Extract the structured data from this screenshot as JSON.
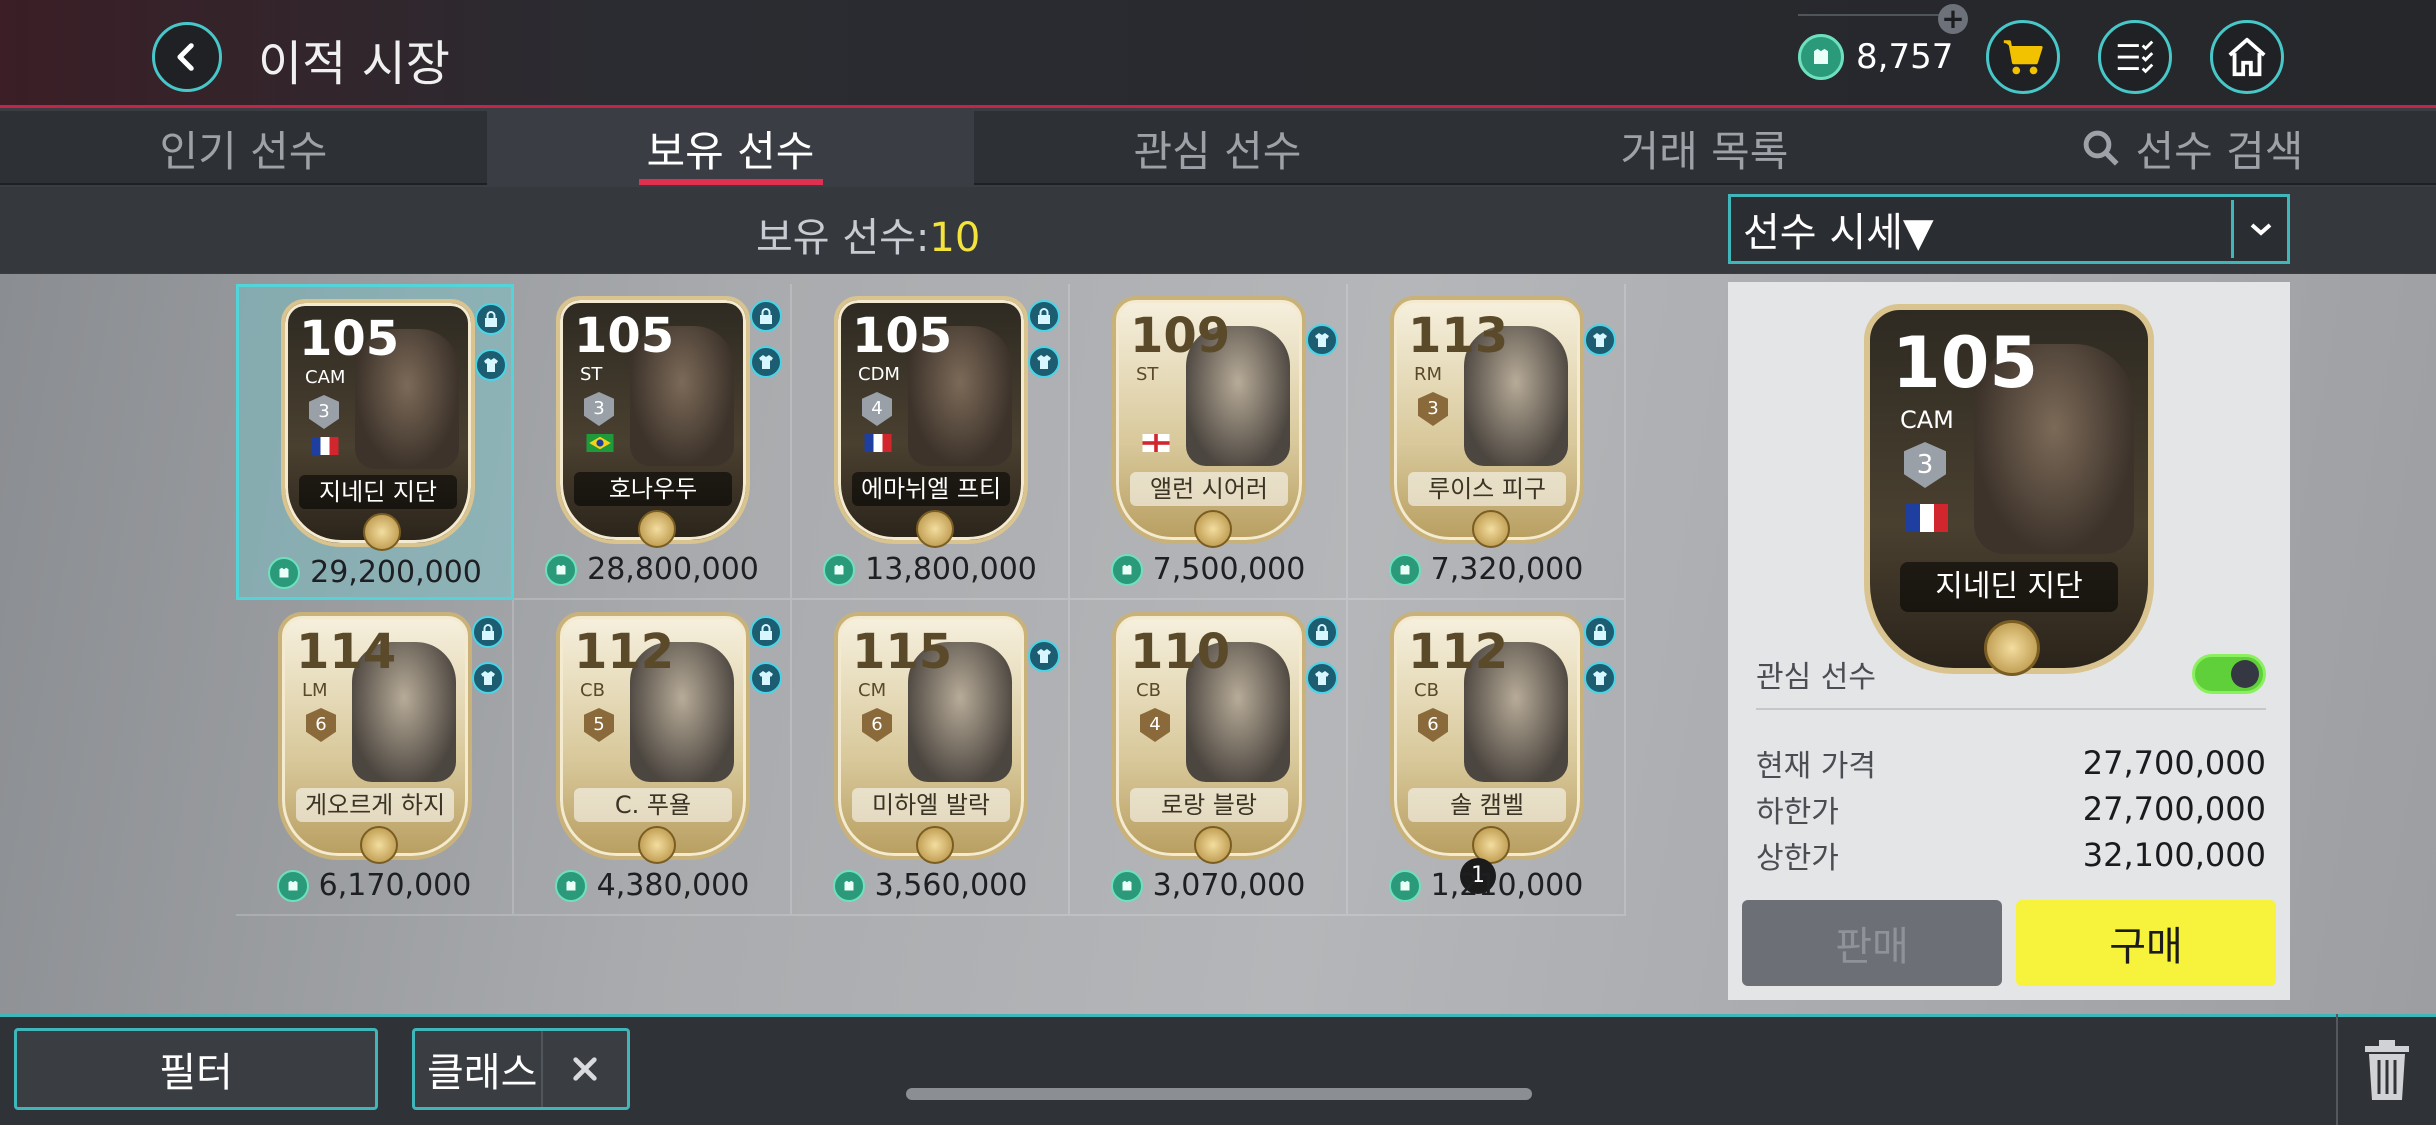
{
  "header": {
    "title": "이적 시장",
    "currency": "8,757",
    "icons": [
      "back-icon",
      "coin-icon",
      "plus-icon",
      "cart-icon",
      "list-check-icon",
      "home-icon"
    ]
  },
  "tabs": [
    {
      "label": "인기 선수",
      "active": false
    },
    {
      "label": "보유 선수",
      "active": true
    },
    {
      "label": "관심 선수",
      "active": false
    },
    {
      "label": "거래 목록",
      "active": false
    },
    {
      "label": "선수 검색",
      "active": false,
      "icon": "search-icon"
    }
  ],
  "owned": {
    "label": "보유 선수:",
    "count": "10"
  },
  "sort": {
    "selected": "선수 시세▼"
  },
  "players": [
    {
      "ovr": "105",
      "pos": "CAM",
      "lvl": "3",
      "name": "지네딘 지단",
      "price": "29,200,000",
      "dark": true,
      "locked": true,
      "selected": true,
      "flag": "fr"
    },
    {
      "ovr": "105",
      "pos": "ST",
      "lvl": "3",
      "name": "호나우두",
      "price": "28,800,000",
      "dark": true,
      "locked": true,
      "flag": "br"
    },
    {
      "ovr": "105",
      "pos": "CDM",
      "lvl": "4",
      "name": "에마뉘엘 프티",
      "price": "13,800,000",
      "dark": true,
      "locked": true,
      "flag": "fr"
    },
    {
      "ovr": "109",
      "pos": "ST",
      "lvl": "",
      "name": "앨런 시어러",
      "price": "7,500,000",
      "dark": false,
      "locked": false,
      "flag": "en"
    },
    {
      "ovr": "113",
      "pos": "RM",
      "lvl": "3",
      "name": "루이스 피구",
      "price": "7,320,000",
      "dark": false,
      "locked": false,
      "flag": ""
    },
    {
      "ovr": "114",
      "pos": "LM",
      "lvl": "6",
      "name": "게오르게 하지",
      "price": "6,170,000",
      "dark": false,
      "locked": true,
      "flag": ""
    },
    {
      "ovr": "112",
      "pos": "CB",
      "lvl": "5",
      "name": "C. 푸욜",
      "price": "4,380,000",
      "dark": false,
      "locked": true,
      "flag": ""
    },
    {
      "ovr": "115",
      "pos": "CM",
      "lvl": "6",
      "name": "미하엘 발락",
      "price": "3,560,000",
      "dark": false,
      "locked": false,
      "flag": ""
    },
    {
      "ovr": "110",
      "pos": "CB",
      "lvl": "4",
      "name": "로랑 블랑",
      "price": "3,070,000",
      "dark": false,
      "locked": true,
      "flag": ""
    },
    {
      "ovr": "112",
      "pos": "CB",
      "lvl": "6",
      "name": "솔 캠벨",
      "price": "1,210,000",
      "dark": false,
      "locked": true,
      "flag": "",
      "rank": "1"
    }
  ],
  "detail": {
    "ovr": "105",
    "pos": "CAM",
    "lvl": "3",
    "name": "지네딘 지단",
    "watch_label": "관심 선수",
    "watch_on": true,
    "rows": [
      {
        "label": "현재 가격",
        "value": "27,700,000"
      },
      {
        "label": "하한가",
        "value": "27,700,000"
      },
      {
        "label": "상한가",
        "value": "32,100,000"
      }
    ],
    "sell_label": "판매",
    "buy_label": "구매"
  },
  "bottom": {
    "filter_label": "필터",
    "chip_label": "클래스"
  },
  "colors": {
    "accent": "#3fb6b9",
    "tab_underline": "#e0304f",
    "buy": "#f7f23c",
    "owned_count": "#f4e33a"
  }
}
